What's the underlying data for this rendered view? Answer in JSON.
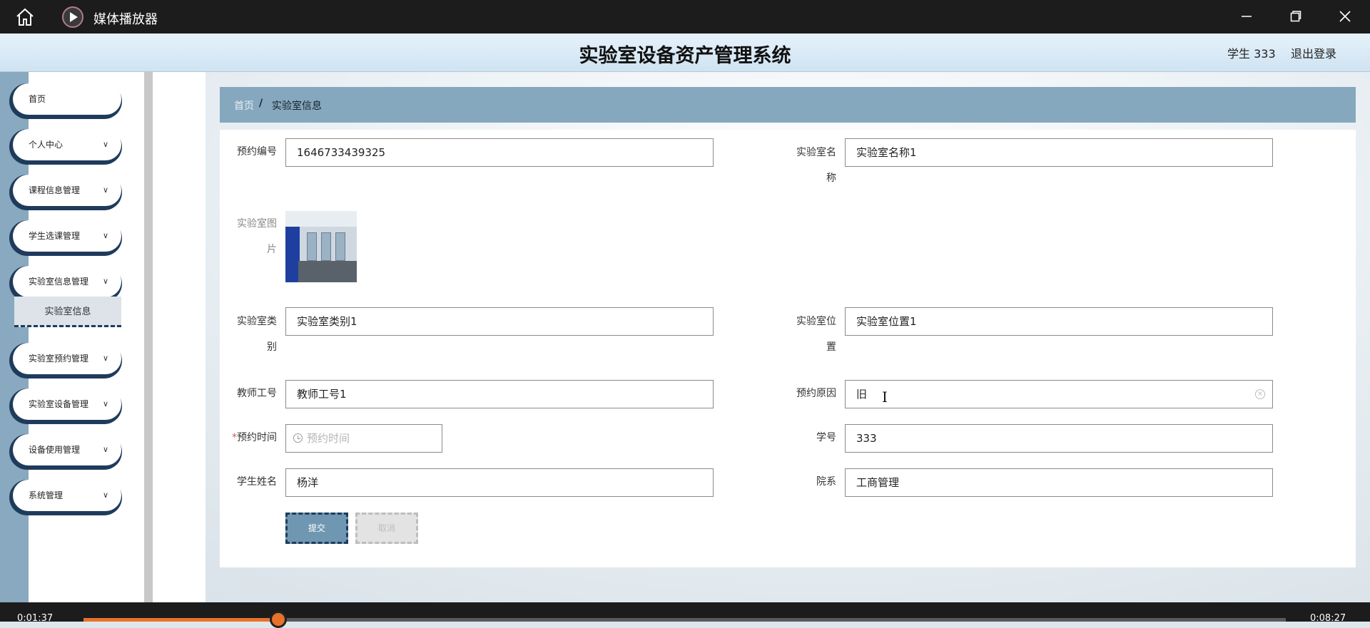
{
  "player": {
    "title": "媒体播放器",
    "time_elapsed": "0:01:37",
    "time_remaining": "0:08:27",
    "progress_fraction": 0.162,
    "accent": "#e8722a"
  },
  "header": {
    "system_title": "实验室设备资产管理系统",
    "user": "学生 333",
    "logout": "退出登录"
  },
  "sidebar": {
    "items": [
      {
        "label": "首页",
        "has_chevron": false
      },
      {
        "label": "个人中心",
        "has_chevron": true
      },
      {
        "label": "课程信息管理",
        "has_chevron": true
      },
      {
        "label": "学生选课管理",
        "has_chevron": true
      },
      {
        "label": "实验室信息管理",
        "has_chevron": true
      },
      {
        "label": "实验室预约管理",
        "has_chevron": true
      },
      {
        "label": "实验室设备管理",
        "has_chevron": true
      },
      {
        "label": "设备使用管理",
        "has_chevron": true
      },
      {
        "label": "系统管理",
        "has_chevron": true
      }
    ],
    "submenu_active": "实验室信息",
    "chevron": "∨"
  },
  "breadcrumb": {
    "home": "首页",
    "separator": "/",
    "current": "实验室信息"
  },
  "form": {
    "booking_no": {
      "label": "预约编号",
      "value": "1646733439325"
    },
    "lab_name": {
      "label1": "实验室名",
      "label2": "称",
      "value": "实验室名称1"
    },
    "lab_image": {
      "label1": "实验室图",
      "label2": "片"
    },
    "lab_type": {
      "label1": "实验室类",
      "label2": "别",
      "value": "实验室类别1"
    },
    "lab_location": {
      "label1": "实验室位",
      "label2": "置",
      "value": "实验室位置1"
    },
    "teacher_no": {
      "label": "教师工号",
      "value": "教师工号1"
    },
    "reason": {
      "label": "预约原因",
      "value": "旧"
    },
    "booking_time": {
      "required_mark": "*",
      "label": "预约时间",
      "placeholder": "预约时间"
    },
    "student_no": {
      "label": "学号",
      "value": "333"
    },
    "student_name": {
      "label": "学生姓名",
      "value": "杨洋"
    },
    "department": {
      "label": "院系",
      "value": "工商管理"
    },
    "submit": "提交",
    "cancel": "取消"
  },
  "colors": {
    "sidebar_accent": "#1f3b5c",
    "breadcrumb_bg": "#86a8be",
    "submit_bg": "#6f97b1"
  }
}
